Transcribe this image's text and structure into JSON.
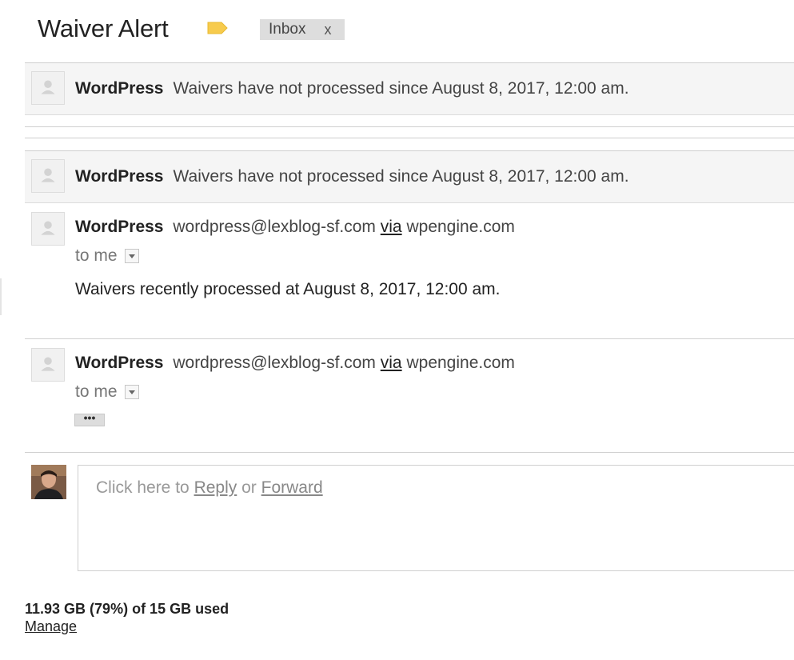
{
  "thread": {
    "subject": "Waiver Alert",
    "label": {
      "name": "Inbox",
      "remove_symbol": "x"
    },
    "important_marker_color": "#f7cb4d"
  },
  "messages": [
    {
      "state": "collapsed",
      "sender": "WordPress",
      "snippet": "Waivers have not processed since August 8, 2017, 12:00 am."
    },
    {
      "state": "collapsed",
      "sender": "WordPress",
      "snippet": "Waivers have not processed since August 8, 2017, 12:00 am."
    },
    {
      "state": "expanded",
      "sender": "WordPress",
      "email": "wordpress@lexblog-sf.com",
      "via_label": "via",
      "via_domain": "wpengine.com",
      "recipient": "to me",
      "body": "Waivers recently processed at August 8, 2017, 12:00 am."
    },
    {
      "state": "expanded",
      "sender": "WordPress",
      "email": "wordpress@lexblog-sf.com",
      "via_label": "via",
      "via_domain": "wpengine.com",
      "recipient": "to me",
      "trimmed_content_label": "•••"
    }
  ],
  "reply": {
    "prefix": "Click here to",
    "reply_label": "Reply",
    "or_label": "or",
    "forward_label": "Forward"
  },
  "storage": {
    "usage": "11.93 GB (79%) of 15 GB used",
    "manage_label": "Manage"
  },
  "colors": {
    "collapsed_row_bg": "#f5f5f5",
    "label_chip_bg": "#dddddd",
    "divider": "#cfcfcf"
  }
}
